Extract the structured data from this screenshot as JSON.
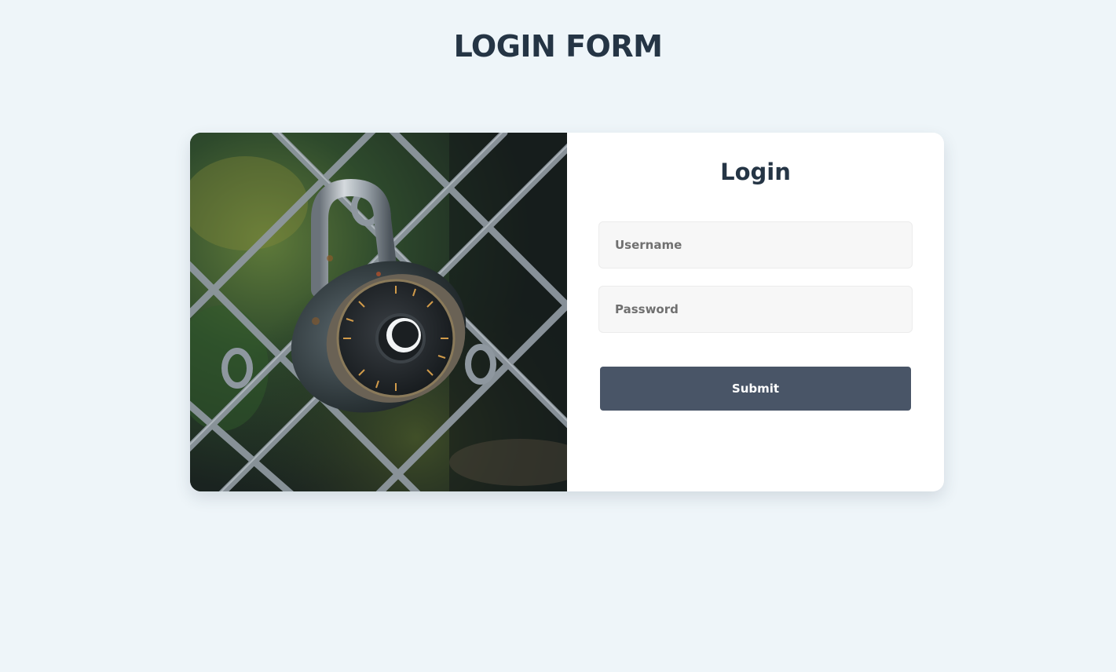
{
  "page": {
    "title": "LOGIN FORM",
    "background_color": "#eef5f9"
  },
  "login_card": {
    "image": {
      "subject": "combination padlock on chain-link fence"
    },
    "form": {
      "title": "Login",
      "username": {
        "placeholder": "Username",
        "value": ""
      },
      "password": {
        "placeholder": "Password",
        "value": ""
      },
      "submit_label": "Submit",
      "submit_color": "#495567",
      "title_color": "#253545"
    }
  }
}
